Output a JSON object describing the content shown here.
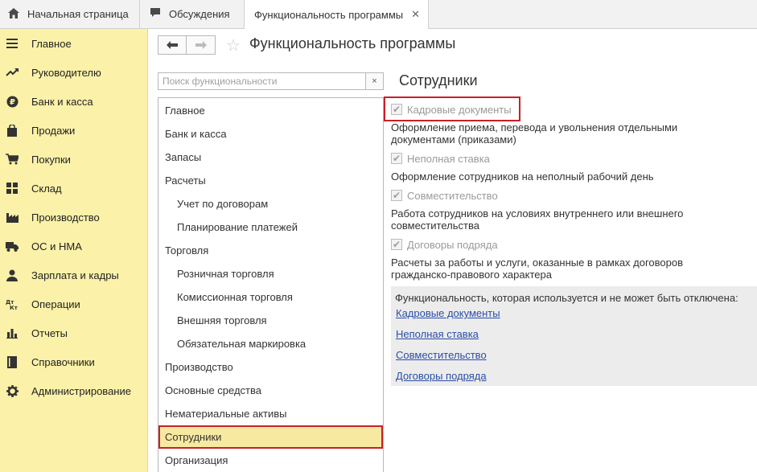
{
  "tabs": [
    {
      "label": "Начальная страница",
      "icon": "home-icon"
    },
    {
      "label": "Обсуждения",
      "icon": "chat-icon"
    },
    {
      "label": "Функциональность программы",
      "icon": "close-icon",
      "active": true
    }
  ],
  "sidebar": {
    "items": [
      {
        "label": "Главное",
        "icon": "menu-icon"
      },
      {
        "label": "Руководителю",
        "icon": "trend-icon"
      },
      {
        "label": "Банк и касса",
        "icon": "ruble-icon"
      },
      {
        "label": "Продажи",
        "icon": "bag-icon"
      },
      {
        "label": "Покупки",
        "icon": "cart-icon"
      },
      {
        "label": "Склад",
        "icon": "grid-icon"
      },
      {
        "label": "Производство",
        "icon": "factory-icon"
      },
      {
        "label": "ОС и НМА",
        "icon": "truck-icon"
      },
      {
        "label": "Зарплата и кадры",
        "icon": "person-icon"
      },
      {
        "label": "Операции",
        "icon": "dt-kt-icon"
      },
      {
        "label": "Отчеты",
        "icon": "bar-chart-icon"
      },
      {
        "label": "Справочники",
        "icon": "book-icon"
      },
      {
        "label": "Администрирование",
        "icon": "gear-icon"
      }
    ]
  },
  "header": {
    "title": "Функциональность программы"
  },
  "search": {
    "placeholder": "Поиск функциональности",
    "value": "",
    "clear_label": "×"
  },
  "sections": [
    {
      "label": "Главное"
    },
    {
      "label": "Банк и касса"
    },
    {
      "label": "Запасы"
    },
    {
      "label": "Расчеты"
    },
    {
      "label": "Учет по договорам",
      "child": true
    },
    {
      "label": "Планирование платежей",
      "child": true
    },
    {
      "label": "Торговля"
    },
    {
      "label": "Розничная торговля",
      "child": true
    },
    {
      "label": "Комиссионная торговля",
      "child": true
    },
    {
      "label": "Внешняя торговля",
      "child": true
    },
    {
      "label": "Обязательная маркировка",
      "child": true
    },
    {
      "label": "Производство"
    },
    {
      "label": "Основные средства"
    },
    {
      "label": "Нематериальные активы"
    },
    {
      "label": "Сотрудники",
      "selected": true
    },
    {
      "label": "Организация"
    }
  ],
  "panel": {
    "title": "Сотрудники",
    "options": [
      {
        "label": "Кадровые документы",
        "checked": true,
        "desc": "Оформление приема, перевода и увольнения отдельными документами (приказами)"
      },
      {
        "label": "Неполная ставка",
        "checked": true,
        "desc": "Оформление сотрудников на неполный рабочий день"
      },
      {
        "label": "Совместительство",
        "checked": true,
        "desc": "Работа сотрудников на условиях внутреннего или внешнего совместительства"
      },
      {
        "label": "Договоры подряда",
        "checked": true,
        "desc": "Расчеты за работы и услуги, оказанные в рамках договоров гражданско-правового характера"
      }
    ],
    "info": {
      "title": "Функциональность, которая используется и не может быть отключена:",
      "links": [
        "Кадровые документы",
        "Неполная ставка",
        "Совместительство",
        "Договоры подряда"
      ]
    }
  },
  "colors": {
    "sidebar_bg": "#fbf1a8",
    "selected_bg": "#f8e9a0",
    "highlight_border": "#c8202a",
    "link": "#2b4ea8"
  }
}
